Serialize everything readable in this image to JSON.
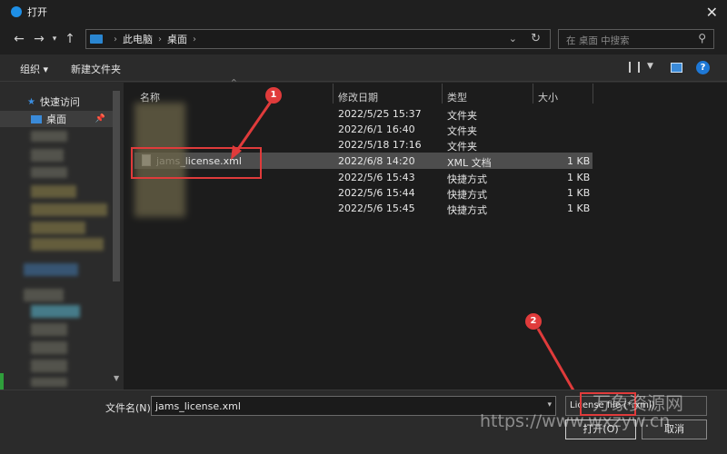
{
  "window": {
    "title": "打开"
  },
  "address": {
    "crumbs": [
      "此电脑",
      "桌面"
    ]
  },
  "search": {
    "placeholder": "在 桌面 中搜索"
  },
  "toolbar": {
    "organize": "组织 ▾",
    "new_folder": "新建文件夹"
  },
  "sidebar": {
    "quick_access": "快速访问",
    "desktop": "桌面"
  },
  "columns": {
    "name": "名称",
    "modified": "修改日期",
    "type": "类型",
    "size": "大小"
  },
  "files": [
    {
      "name": "",
      "modified": "2022/5/25 15:37",
      "type": "文件夹",
      "size": ""
    },
    {
      "name": "",
      "modified": "2022/6/1 16:40",
      "type": "文件夹",
      "size": ""
    },
    {
      "name": "",
      "modified": "2022/5/18 17:16",
      "type": "文件夹",
      "size": ""
    },
    {
      "name": "jams_license.xml",
      "modified": "2022/6/8 14:20",
      "type": "XML 文档",
      "size": "1 KB"
    },
    {
      "name": "",
      "modified": "2022/5/6 15:43",
      "type": "快捷方式",
      "size": "1 KB"
    },
    {
      "name": "",
      "modified": "2022/5/6 15:44",
      "type": "快捷方式",
      "size": "1 KB"
    },
    {
      "name": "",
      "modified": "2022/5/6 15:45",
      "type": "快捷方式",
      "size": "1 KB"
    }
  ],
  "filename": {
    "label": "文件名(N):",
    "value": "jams_license.xml"
  },
  "filter": {
    "value": "License file (*.xml)"
  },
  "buttons": {
    "open": "打开(O)",
    "cancel": "取消"
  },
  "annotations": {
    "one": "1",
    "two": "2"
  },
  "watermark": {
    "line1": "万象资源网",
    "line2": "https://www.wxzyw.cn"
  },
  "colors": {
    "accent": "#1e8fe6",
    "annotation": "#e03b3b",
    "selected_row": "#4d4d4d"
  }
}
